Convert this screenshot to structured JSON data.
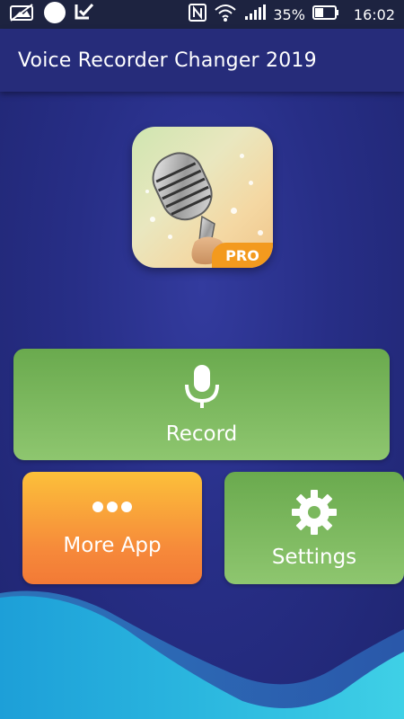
{
  "status_bar": {
    "battery_percent": "35%",
    "time": "16:02"
  },
  "app_bar": {
    "title": "Voice Recorder Changer 2019"
  },
  "logo": {
    "badge": "PRO"
  },
  "buttons": {
    "record": {
      "label": "Record",
      "icon": "microphone-icon"
    },
    "more_app": {
      "label": "More App",
      "icon": "more-dots-icon"
    },
    "settings": {
      "label": "Settings",
      "icon": "gear-icon"
    }
  },
  "colors": {
    "background": "#272e86",
    "app_bar": "#262c7a",
    "status_bar": "#1d2340",
    "green": "#7bb85e",
    "orange": "#f6893a",
    "wave": "#2bb7df"
  }
}
